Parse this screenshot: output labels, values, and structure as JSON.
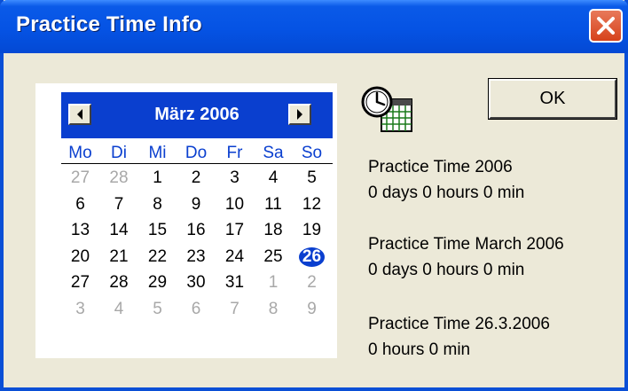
{
  "window": {
    "title": "Practice Time Info"
  },
  "calendar": {
    "month_label": "März 2006",
    "day_names": [
      "Mo",
      "Di",
      "Mi",
      "Do",
      "Fr",
      "Sa",
      "So"
    ],
    "weeks": [
      [
        {
          "d": "27",
          "o": true
        },
        {
          "d": "28",
          "o": true
        },
        {
          "d": "1"
        },
        {
          "d": "2"
        },
        {
          "d": "3"
        },
        {
          "d": "4"
        },
        {
          "d": "5"
        }
      ],
      [
        {
          "d": "6"
        },
        {
          "d": "7"
        },
        {
          "d": "8"
        },
        {
          "d": "9"
        },
        {
          "d": "10"
        },
        {
          "d": "11"
        },
        {
          "d": "12"
        }
      ],
      [
        {
          "d": "13"
        },
        {
          "d": "14"
        },
        {
          "d": "15"
        },
        {
          "d": "16"
        },
        {
          "d": "17"
        },
        {
          "d": "18"
        },
        {
          "d": "19"
        }
      ],
      [
        {
          "d": "20"
        },
        {
          "d": "21"
        },
        {
          "d": "22"
        },
        {
          "d": "23"
        },
        {
          "d": "24"
        },
        {
          "d": "25"
        },
        {
          "d": "26",
          "sel": true
        }
      ],
      [
        {
          "d": "27"
        },
        {
          "d": "28"
        },
        {
          "d": "29"
        },
        {
          "d": "30"
        },
        {
          "d": "31"
        },
        {
          "d": "1",
          "o": true
        },
        {
          "d": "2",
          "o": true
        }
      ],
      [
        {
          "d": "3",
          "o": true
        },
        {
          "d": "4",
          "o": true
        },
        {
          "d": "5",
          "o": true
        },
        {
          "d": "6",
          "o": true
        },
        {
          "d": "7",
          "o": true
        },
        {
          "d": "8",
          "o": true
        },
        {
          "d": "9",
          "o": true
        }
      ]
    ],
    "prev_icon": "left-arrow-icon",
    "next_icon": "right-arrow-icon"
  },
  "ok_label": "OK",
  "icon": "clock-calendar-icon",
  "info": {
    "year_label": "Practice Time 2006",
    "year_value": "0 days 0 hours 0 min",
    "month_label": "Practice Time March 2006",
    "month_value": "0 days 0 hours 0 min",
    "day_label": "Practice Time 26.3.2006",
    "day_value": "0 hours 0 min"
  }
}
